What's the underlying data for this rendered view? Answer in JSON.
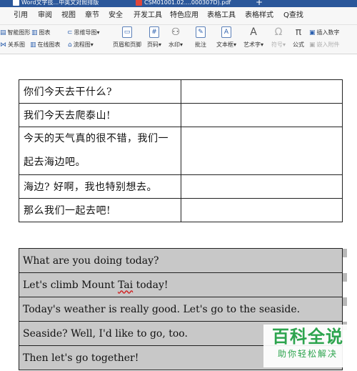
{
  "titlebar": {
    "tab_word": "Word文字技...中英文对照排版",
    "tab_pdf": "CSM01001.02....000307D).pdf",
    "new_tab": "+"
  },
  "menu": {
    "items": [
      "引用",
      "审阅",
      "视图",
      "章节",
      "安全",
      "开发工具",
      "特色应用",
      "表格工具",
      "表格样式"
    ],
    "search": "Q查找"
  },
  "toolbar": {
    "smartart": "智能图形",
    "chart": "图表",
    "mindmap": "思维导图",
    "relation": "关系图",
    "online_chart": "在线图表",
    "flowchart": "流程图",
    "header_footer": "页眉和页脚",
    "page_number": "页码",
    "watermark": "水印",
    "comment": "批注",
    "textbox": "文本框",
    "wordart": "艺术字",
    "symbol": "符号",
    "formula": "公式",
    "insert_number": "插入数字",
    "embed_attachment": "嵌入附件",
    "chevron": "▾"
  },
  "chinese_table": {
    "rows": [
      "你们今天去干什么?",
      "我们今天去爬泰山!",
      "今天的天气真的很不错，我们一",
      "起去海边吧。",
      "海边? 好啊，我也特别想去。",
      "那么我们一起去吧!"
    ]
  },
  "english_table": {
    "row1": "What are you doing today?",
    "row2_a": "Let's climb Mount ",
    "row2_b": "Tai",
    "row2_c": " today!",
    "row3": "Today's weather is really good. Let's go to the seaside.",
    "row4": "Seaside? Well, I'd like to go, too.",
    "row5": "Then let's go together!"
  },
  "watermark": {
    "brand": "百科全说",
    "slogan": "助你轻松解决"
  }
}
